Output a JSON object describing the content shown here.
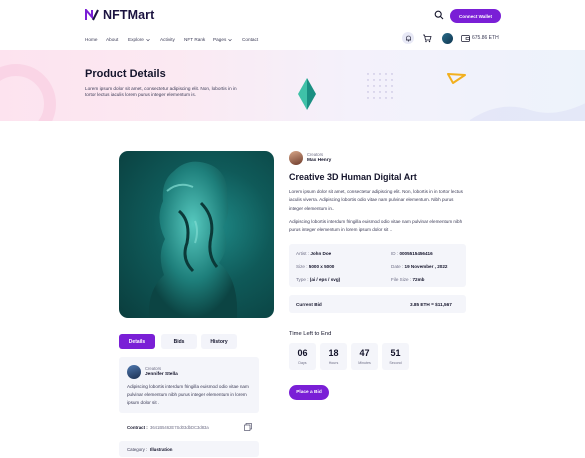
{
  "brand": {
    "name": "NFTMart",
    "accent": "#7a1fd6"
  },
  "header": {
    "connect_label": "Connect Wallet"
  },
  "nav": {
    "items": [
      {
        "label": "Home"
      },
      {
        "label": "About"
      },
      {
        "label": "Explore"
      },
      {
        "label": "Activity"
      },
      {
        "label": "NFT Rank"
      },
      {
        "label": "Pages"
      },
      {
        "label": "Contact"
      }
    ],
    "eth_balance": "675.86 ETH"
  },
  "hero": {
    "title": "Product Details",
    "subtitle": "Lorem ipsum dolor sit amet, consectetur adipiscing elit. Non, lobortis in in tortor lectus iaculis lorem purus integer elementum is."
  },
  "tabs": [
    {
      "label": "Details"
    },
    {
      "label": "Bids"
    },
    {
      "label": "History"
    }
  ],
  "details_panel": {
    "creator_label": "Creators",
    "creator_name": "Jennifer Stella",
    "description": "Adipiscing lobortis interdum fringilla euismod odio vitae nam pulvinar elementum nibh purus integer elementum in lorem ipsum dolor sit .",
    "contract_label": "Contract :",
    "contract_value": "3641B5462E7Sd03dbDC3d83a",
    "category_label": "Category :",
    "category_value": "Illustration"
  },
  "product": {
    "creator_label": "Creators",
    "creator_name": "Max Henry",
    "title": "Creative 3D Human Digital Art",
    "desc1": "Lorem ipsum dolor sit amet, consectetur adipiscing elit. Non, lobortis in in tortor lectus iaculis viverra. Adipiscing lobortis odio vitae nam pulvinar elementum. Nibh purus integer elementum in..",
    "desc2": "Adipiscing lobortis interdum fringilla euismod odio vitae nam pulvinar elementum nibh purus integer elementum in lorem ipsum dolor sit ..",
    "artist_label": "Artist :",
    "artist_value": "John Doe",
    "id_label": "ID :",
    "id_value": "0005515456416",
    "size_label": "Size :",
    "size_value": "5000 x 5000",
    "date_label": "Date :",
    "date_value": "19 November , 2022",
    "type_label": "Type :",
    "type_value": "(ai / eps / svg)",
    "filesize_label": "File Size :",
    "filesize_value": "72mb",
    "current_bid_label": "Current Bid",
    "current_bid_value": "3.85 ETH = $11,567"
  },
  "timer": {
    "label": "Time Left to End",
    "units": [
      {
        "value": "06",
        "unit": "Days"
      },
      {
        "value": "18",
        "unit": "Hours"
      },
      {
        "value": "47",
        "unit": "Minutes"
      },
      {
        "value": "51",
        "unit": "Second"
      }
    ]
  },
  "place_bid_label": "Place a Bid"
}
